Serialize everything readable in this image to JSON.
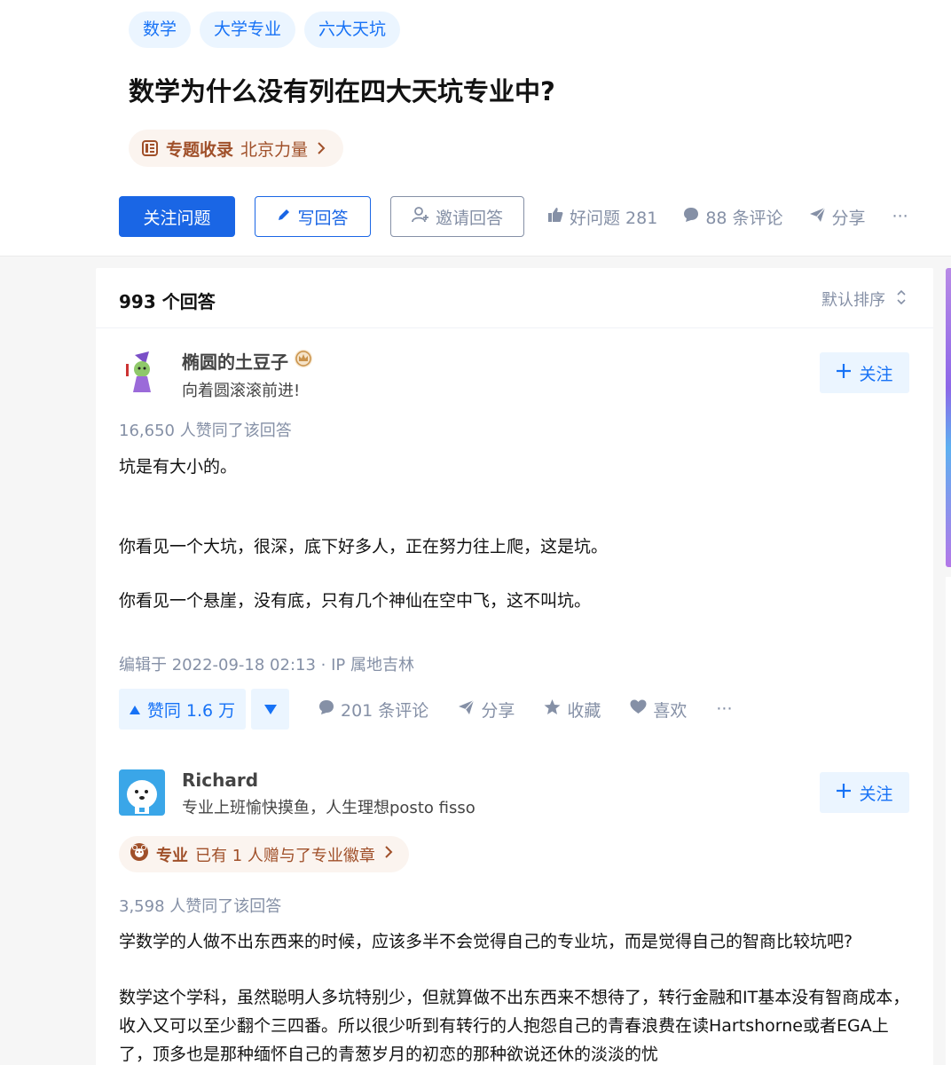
{
  "tags": [
    "数学",
    "大学专业",
    "六大天坑"
  ],
  "question": {
    "title": "数学为什么没有列在四大天坑专业中?",
    "topic_label": "专题收录",
    "topic_name": "北京力量"
  },
  "actions": {
    "follow": "关注问题",
    "write": "写回答",
    "invite": "邀请回答",
    "good": "好问题 281",
    "comments": "88 条评论",
    "share": "分享",
    "more": "···"
  },
  "answers_header": {
    "count": "993 个回答",
    "sort": "默认排序"
  },
  "answer1": {
    "author_name": "椭圆的土豆子",
    "author_bio": "向着圆滚滚前进!",
    "follow_label": "关注",
    "voters": "16,650 人赞同了该回答",
    "paragraphs": [
      "坑是有大小的。",
      "你看见一个大坑，很深，底下好多人，正在努力往上爬，这是坑。",
      "你看见一个悬崖，没有底，只有几个神仙在空中飞，这不叫坑。"
    ],
    "edited": "编辑于 2022-09-18 02:13 · IP 属地吉林",
    "vote_up": "赞同 1.6 万",
    "comments": "201 条评论",
    "share": "分享",
    "collect": "收藏",
    "like": "喜欢",
    "more": "···"
  },
  "answer2": {
    "author_name": "Richard",
    "author_bio": "专业上班愉快摸鱼，人生理想posto fisso",
    "follow_label": "关注",
    "badge_label": "专业",
    "badge_text": "已有 1 人赠与了专业徽章",
    "voters": "3,598 人赞同了该回答",
    "paragraphs": [
      "学数学的人做不出东西来的时候，应该多半不会觉得自己的专业坑，而是觉得自己的智商比较坑吧?",
      "数学这个学科，虽然聪明人多坑特别少，但就算做不出东西来不想待了，转行金融和IT基本没有智商成本，收入又可以至少翻个三四番。所以很少听到有转行的人抱怨自己的青春浪费在读Hartshorne或者EGA上了，顶多也是那种缅怀自己的青葱岁月的初恋的那种欲说还休的淡淡的忧"
    ]
  },
  "colors": {
    "brand_blue": "#1a66e5",
    "link_blue": "#1772f6",
    "tag_bg": "#ebf5ff",
    "meta_gray": "#8590a6",
    "topic_brown": "#a0502a"
  }
}
